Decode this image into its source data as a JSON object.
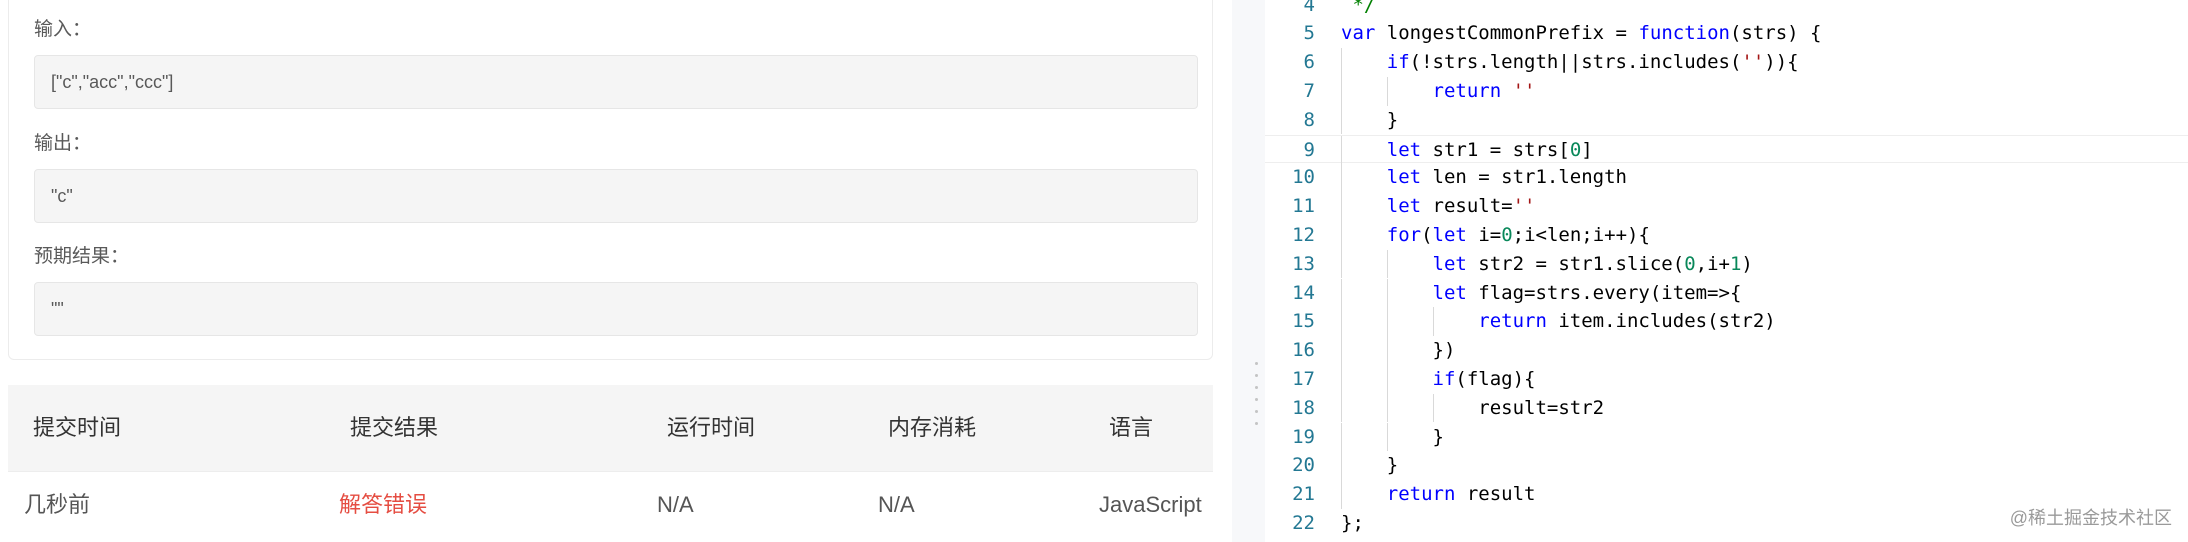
{
  "testcase": {
    "input_label": "输入：",
    "input_value": "[\"c\",\"acc\",\"ccc\"]",
    "output_label": "输出：",
    "output_value": "\"c\"",
    "expected_label": "预期结果：",
    "expected_value": "\"\""
  },
  "submissions": {
    "headers": [
      "提交时间",
      "提交结果",
      "运行时间",
      "内存消耗",
      "语言"
    ],
    "rows": [
      {
        "time": "几秒前",
        "result": "解答错误",
        "runtime": "N/A",
        "memory": "N/A",
        "language": "JavaScript"
      }
    ]
  },
  "colors": {
    "error": "#e54d42",
    "keyword": "#0000ff",
    "number": "#09885a",
    "string": "#a31515",
    "line_number": "#237893"
  },
  "editor": {
    "lines": [
      {
        "n": "4",
        "segs": [
          {
            "t": " */",
            "c": "cmt"
          }
        ]
      },
      {
        "n": "5",
        "segs": [
          {
            "t": "var",
            "c": "kw"
          },
          {
            "t": " longestCommonPrefix = "
          },
          {
            "t": "function",
            "c": "kw"
          },
          {
            "t": "(strs) {"
          }
        ]
      },
      {
        "n": "6",
        "segs": [
          {
            "t": "    "
          },
          {
            "t": "if",
            "c": "kw"
          },
          {
            "t": "(!strs.length||strs.includes("
          },
          {
            "t": "''",
            "c": "str"
          },
          {
            "t": ")){"
          }
        ]
      },
      {
        "n": "7",
        "segs": [
          {
            "t": "        "
          },
          {
            "t": "return",
            "c": "kw"
          },
          {
            "t": " "
          },
          {
            "t": "''",
            "c": "str"
          }
        ]
      },
      {
        "n": "8",
        "segs": [
          {
            "t": "    }"
          }
        ]
      },
      {
        "n": "9",
        "segs": [
          {
            "t": "    "
          },
          {
            "t": "let",
            "c": "kw"
          },
          {
            "t": " str1 = strs["
          },
          {
            "t": "0",
            "c": "num"
          },
          {
            "t": "]"
          }
        ]
      },
      {
        "n": "10",
        "segs": [
          {
            "t": "    "
          },
          {
            "t": "let",
            "c": "kw"
          },
          {
            "t": " len = str1.length"
          }
        ]
      },
      {
        "n": "11",
        "segs": [
          {
            "t": "    "
          },
          {
            "t": "let",
            "c": "kw"
          },
          {
            "t": " result="
          },
          {
            "t": "''",
            "c": "str"
          }
        ]
      },
      {
        "n": "12",
        "segs": [
          {
            "t": "    "
          },
          {
            "t": "for",
            "c": "kw"
          },
          {
            "t": "("
          },
          {
            "t": "let",
            "c": "kw"
          },
          {
            "t": " i="
          },
          {
            "t": "0",
            "c": "num"
          },
          {
            "t": ";i<len;i++){"
          }
        ]
      },
      {
        "n": "13",
        "segs": [
          {
            "t": "        "
          },
          {
            "t": "let",
            "c": "kw"
          },
          {
            "t": " str2 = str1.slice("
          },
          {
            "t": "0",
            "c": "num"
          },
          {
            "t": ",i+"
          },
          {
            "t": "1",
            "c": "num"
          },
          {
            "t": ")"
          }
        ]
      },
      {
        "n": "14",
        "segs": [
          {
            "t": "        "
          },
          {
            "t": "let",
            "c": "kw"
          },
          {
            "t": " flag=strs.every(item=>{"
          }
        ]
      },
      {
        "n": "15",
        "segs": [
          {
            "t": "            "
          },
          {
            "t": "return",
            "c": "kw"
          },
          {
            "t": " item.includes(str2)"
          }
        ]
      },
      {
        "n": "16",
        "segs": [
          {
            "t": "        })"
          }
        ]
      },
      {
        "n": "17",
        "segs": [
          {
            "t": "        "
          },
          {
            "t": "if",
            "c": "kw"
          },
          {
            "t": "(flag){"
          }
        ]
      },
      {
        "n": "18",
        "segs": [
          {
            "t": "            result=str2"
          }
        ]
      },
      {
        "n": "19",
        "segs": [
          {
            "t": "        }"
          }
        ]
      },
      {
        "n": "20",
        "segs": [
          {
            "t": "    }"
          }
        ]
      },
      {
        "n": "21",
        "segs": [
          {
            "t": "    "
          },
          {
            "t": "return",
            "c": "kw"
          },
          {
            "t": " result"
          }
        ]
      },
      {
        "n": "22",
        "segs": [
          {
            "t": "};"
          }
        ]
      }
    ]
  },
  "watermark": "@稀土掘金技术社区"
}
